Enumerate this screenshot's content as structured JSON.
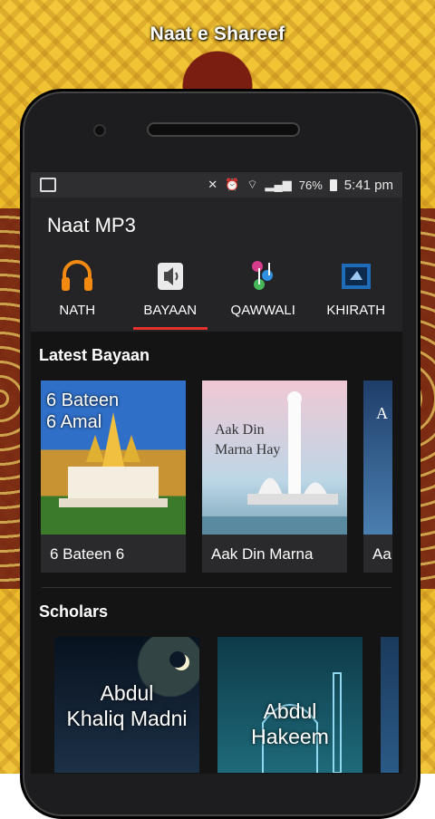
{
  "banner_title": "Naat e Shareef",
  "status": {
    "battery": "76%",
    "time": "5:41 pm"
  },
  "app": {
    "title": "Naat MP3"
  },
  "tabs": [
    {
      "label": "NATH",
      "icon": "headphones-icon"
    },
    {
      "label": "BAYAAN",
      "icon": "speaker-icon",
      "active": true
    },
    {
      "label": "QAWWALI",
      "icon": "music-notes-icon"
    },
    {
      "label": "KHIRATH",
      "icon": "book-icon"
    }
  ],
  "latest": {
    "title": "Latest Bayaan",
    "items": [
      {
        "caption": "6 Bateen 6",
        "overlay": "6 Bateen\n6 Amal"
      },
      {
        "caption": "Aak Din Marna",
        "overlay": "Aak Din\nMarna Hay"
      },
      {
        "caption": "Aa",
        "overlay": "A"
      }
    ]
  },
  "scholars": {
    "title": "Scholars",
    "items": [
      {
        "name": "Abdul\nKhaliq Madni"
      },
      {
        "name": "Abdul\nHakeem"
      }
    ]
  },
  "colors": {
    "accent": "#e5322d",
    "background": "#141414",
    "appbar": "#242426"
  }
}
